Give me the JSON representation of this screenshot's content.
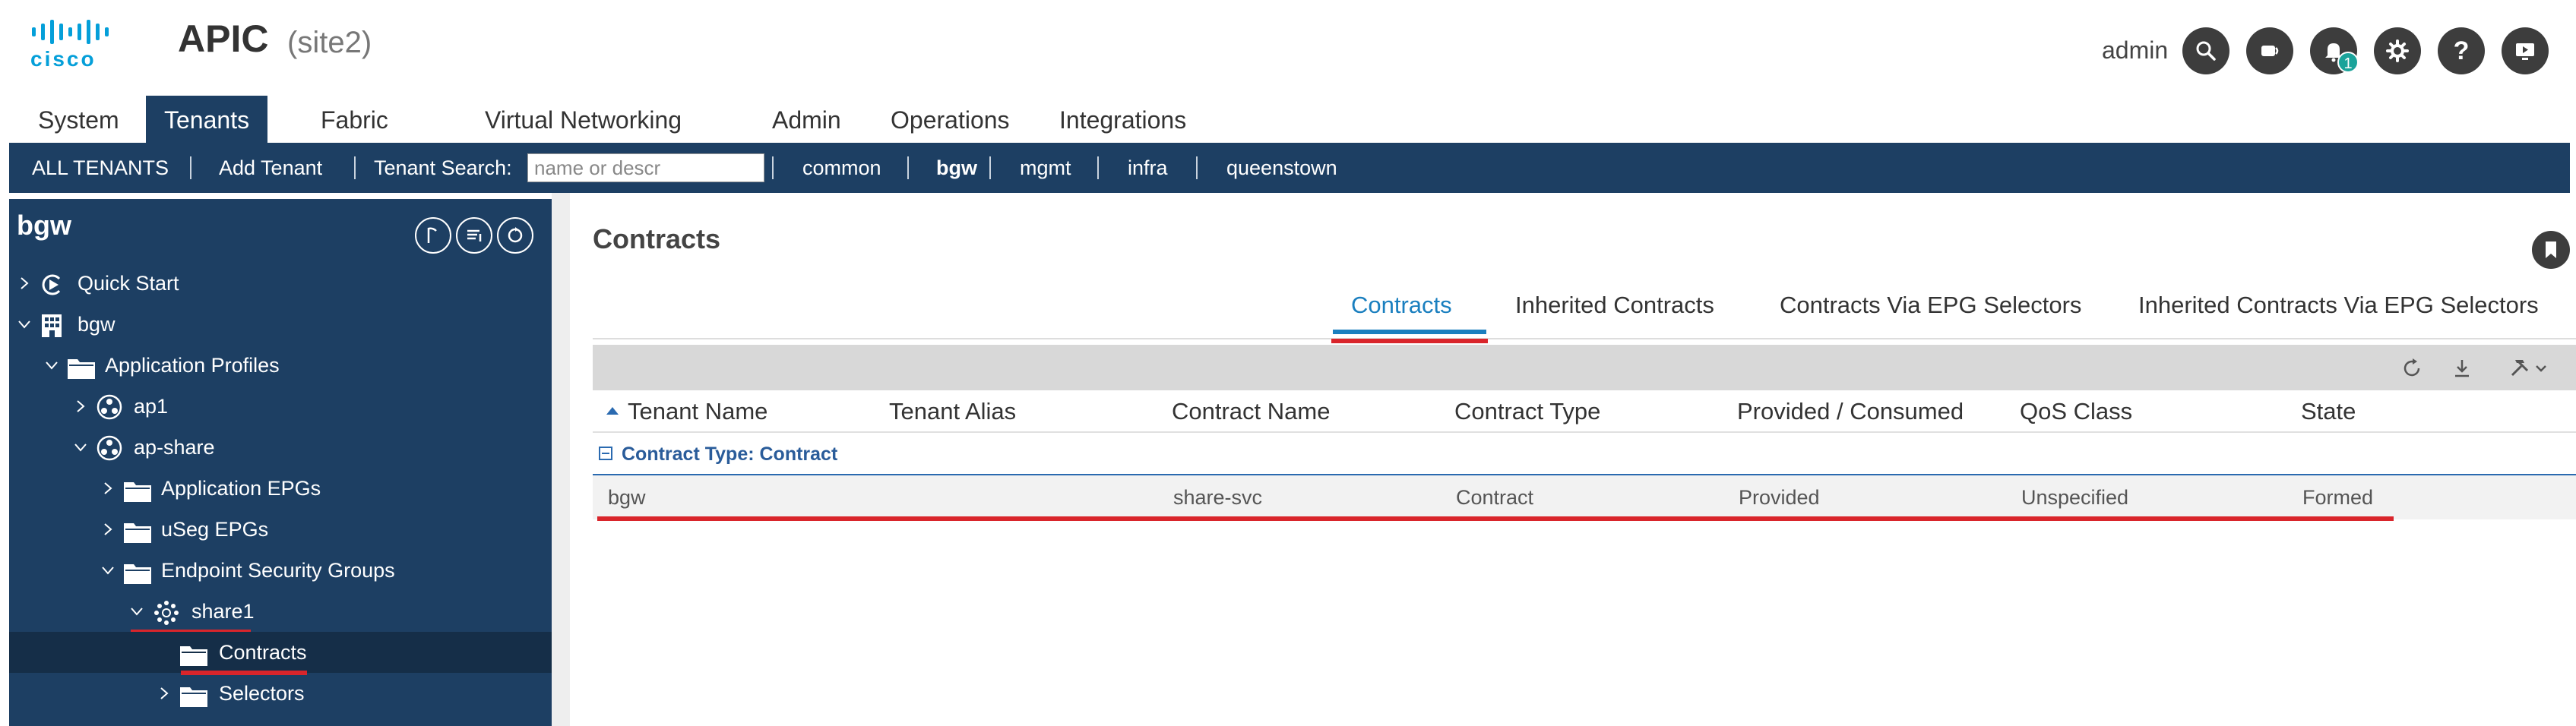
{
  "header": {
    "logo_text": "cisco",
    "app_title": "APIC",
    "site": "(site2)",
    "username": "admin",
    "notification_count": "1",
    "icons": [
      "search-icon",
      "announcement-icon",
      "bell-icon",
      "gear-icon",
      "help-icon",
      "screen-icon"
    ]
  },
  "main_nav": {
    "tabs": [
      {
        "label": "System"
      },
      {
        "label": "Tenants",
        "active": true
      },
      {
        "label": "Fabric"
      },
      {
        "label": "Virtual Networking"
      },
      {
        "label": "Admin"
      },
      {
        "label": "Operations"
      },
      {
        "label": "Integrations"
      }
    ]
  },
  "sub_nav": {
    "all_tenants": "ALL TENANTS",
    "add_tenant": "Add Tenant",
    "tenant_search_label": "Tenant Search:",
    "tenant_search_placeholder": "name or descr",
    "tenants": [
      "common",
      "bgw",
      "mgmt",
      "infra",
      "queenstown"
    ],
    "active_tenant": "bgw"
  },
  "sidebar": {
    "title": "bgw",
    "tree": [
      {
        "label": "Quick Start",
        "icon": "quick-start-icon",
        "expanded": false
      },
      {
        "label": "bgw",
        "icon": "building-icon",
        "expanded": true
      },
      {
        "label": "Application Profiles",
        "icon": "folder-icon",
        "expanded": true
      },
      {
        "label": "ap1",
        "icon": "app-profile-icon",
        "expanded": false
      },
      {
        "label": "ap-share",
        "icon": "app-profile-icon",
        "expanded": true
      },
      {
        "label": "Application EPGs",
        "icon": "folder-icon",
        "expanded": false
      },
      {
        "label": "uSeg EPGs",
        "icon": "folder-icon",
        "expanded": false
      },
      {
        "label": "Endpoint Security Groups",
        "icon": "folder-icon",
        "expanded": true
      },
      {
        "label": "share1",
        "icon": "esg-icon",
        "expanded": true
      },
      {
        "label": "Contracts",
        "icon": "folder-icon",
        "selected": true
      },
      {
        "label": "Selectors",
        "icon": "folder-icon",
        "expanded": false
      }
    ]
  },
  "content": {
    "title": "Contracts",
    "tabs": [
      {
        "label": "Contracts",
        "active": true
      },
      {
        "label": "Inherited Contracts"
      },
      {
        "label": "Contracts Via EPG Selectors"
      },
      {
        "label": "Inherited Contracts Via EPG Selectors"
      }
    ],
    "table": {
      "columns": [
        "Tenant Name",
        "Tenant Alias",
        "Contract Name",
        "Contract Type",
        "Provided / Consumed",
        "QoS Class",
        "State"
      ],
      "group_label": "Contract Type: Contract",
      "rows": [
        [
          "bgw",
          "",
          "share-svc",
          "Contract",
          "Provided",
          "Unspecified",
          "Formed"
        ]
      ]
    }
  },
  "colors": {
    "nav_blue": "#1d3f63",
    "accent_blue": "#1a7fbf",
    "highlight_red": "#d9252b",
    "cisco_blue": "#049fd9"
  }
}
